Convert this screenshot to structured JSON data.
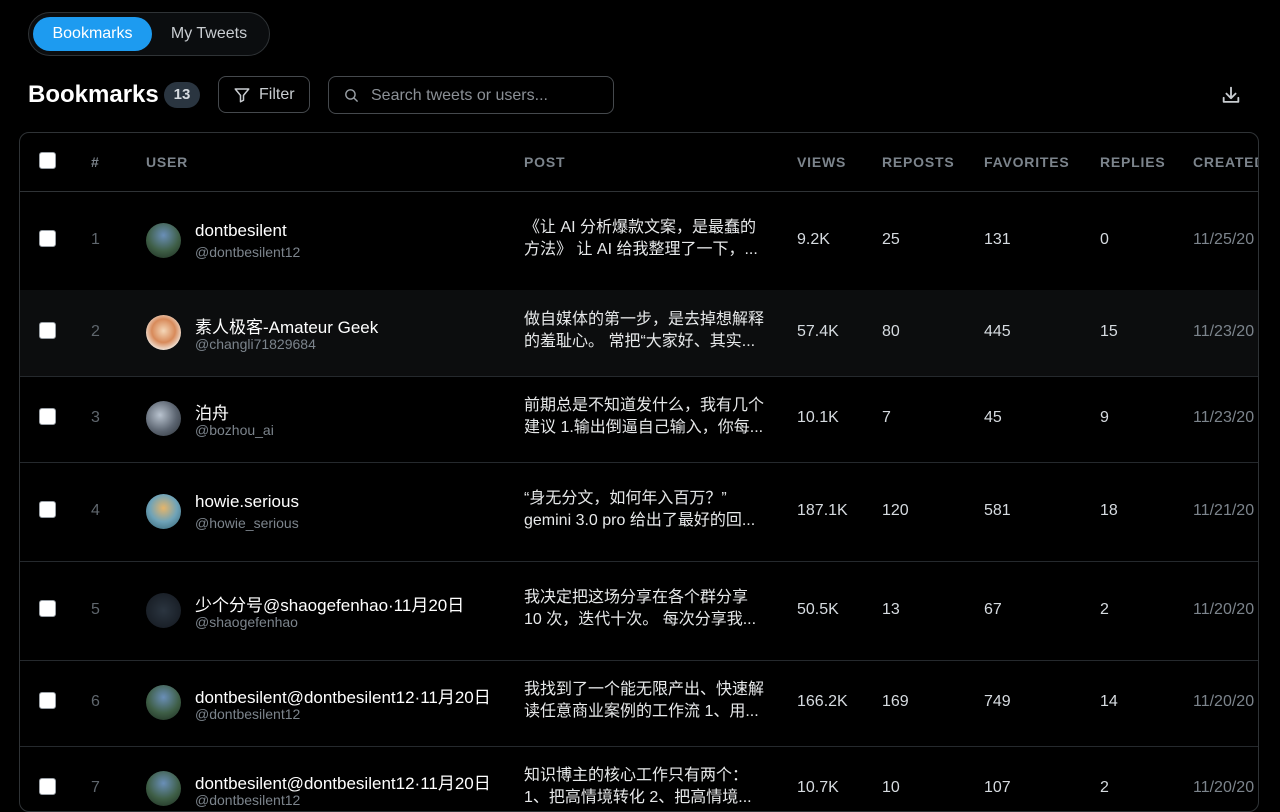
{
  "tabs": {
    "active": "Bookmarks",
    "inactive": "My Tweets"
  },
  "header": {
    "title": "Bookmarks",
    "count": "13",
    "filter_label": "Filter",
    "search_placeholder": "Search tweets or users..."
  },
  "table": {
    "columns": {
      "num": "#",
      "user": "USER",
      "post": "POST",
      "views": "VIEWS",
      "reposts": "REPOSTS",
      "favorites": "FAVORITES",
      "replies": "REPLIES",
      "created": "CREATED"
    },
    "rows": [
      {
        "num": "1",
        "name": "dontbesilent",
        "handle": "@dontbesilent12",
        "post1": "《让 AI 分析爆款文案，是最蠢的",
        "post2": "方法》 让 AI 给我整理了一下，...",
        "views": "9.2K",
        "reposts": "25",
        "favorites": "131",
        "replies": "0",
        "created": "11/25/20"
      },
      {
        "num": "2",
        "name": "素人极客-Amateur Geek",
        "handle": "@changli71829684",
        "post1": "做自媒体的第一步，是去掉想解释",
        "post2": "的羞耻心。 常把“大家好、其实...",
        "views": "57.4K",
        "reposts": "80",
        "favorites": "445",
        "replies": "15",
        "created": "11/23/20"
      },
      {
        "num": "3",
        "name": "泊舟",
        "handle": "@bozhou_ai",
        "post1": "前期总是不知道发什么，我有几个",
        "post2": "建议 1.输出倒逼自己输入，你每...",
        "views": "10.1K",
        "reposts": "7",
        "favorites": "45",
        "replies": "9",
        "created": "11/23/20"
      },
      {
        "num": "4",
        "name": "howie.serious",
        "handle": "@howie_serious",
        "post1": "“身无分文，如何年入百万？”",
        "post2": "gemini 3.0 pro 给出了最好的回...",
        "views": "187.1K",
        "reposts": "120",
        "favorites": "581",
        "replies": "18",
        "created": "11/21/20"
      },
      {
        "num": "5",
        "name": "少个分号@shaogefenhao·11月20日",
        "handle": "@shaogefenhao",
        "post1": "我决定把这场分享在各个群分享",
        "post2": "10 次，迭代十次。 每次分享我...",
        "views": "50.5K",
        "reposts": "13",
        "favorites": "67",
        "replies": "2",
        "created": "11/20/20"
      },
      {
        "num": "6",
        "name": "dontbesilent@dontbesilent12·11月20日",
        "handle": "@dontbesilent12",
        "post1": "我找到了一个能无限产出、快速解",
        "post2": "读任意商业案例的工作流 1、用...",
        "views": "166.2K",
        "reposts": "169",
        "favorites": "749",
        "replies": "14",
        "created": "11/20/20"
      },
      {
        "num": "7",
        "name": "dontbesilent@dontbesilent12·11月20日",
        "handle": "@dontbesilent12",
        "post1": "知识博主的核心工作只有两个：",
        "post2": "1、把高情境转化 2、把高情境...",
        "views": "10.7K",
        "reposts": "10",
        "favorites": "107",
        "replies": "2",
        "created": "11/20/20"
      }
    ]
  }
}
